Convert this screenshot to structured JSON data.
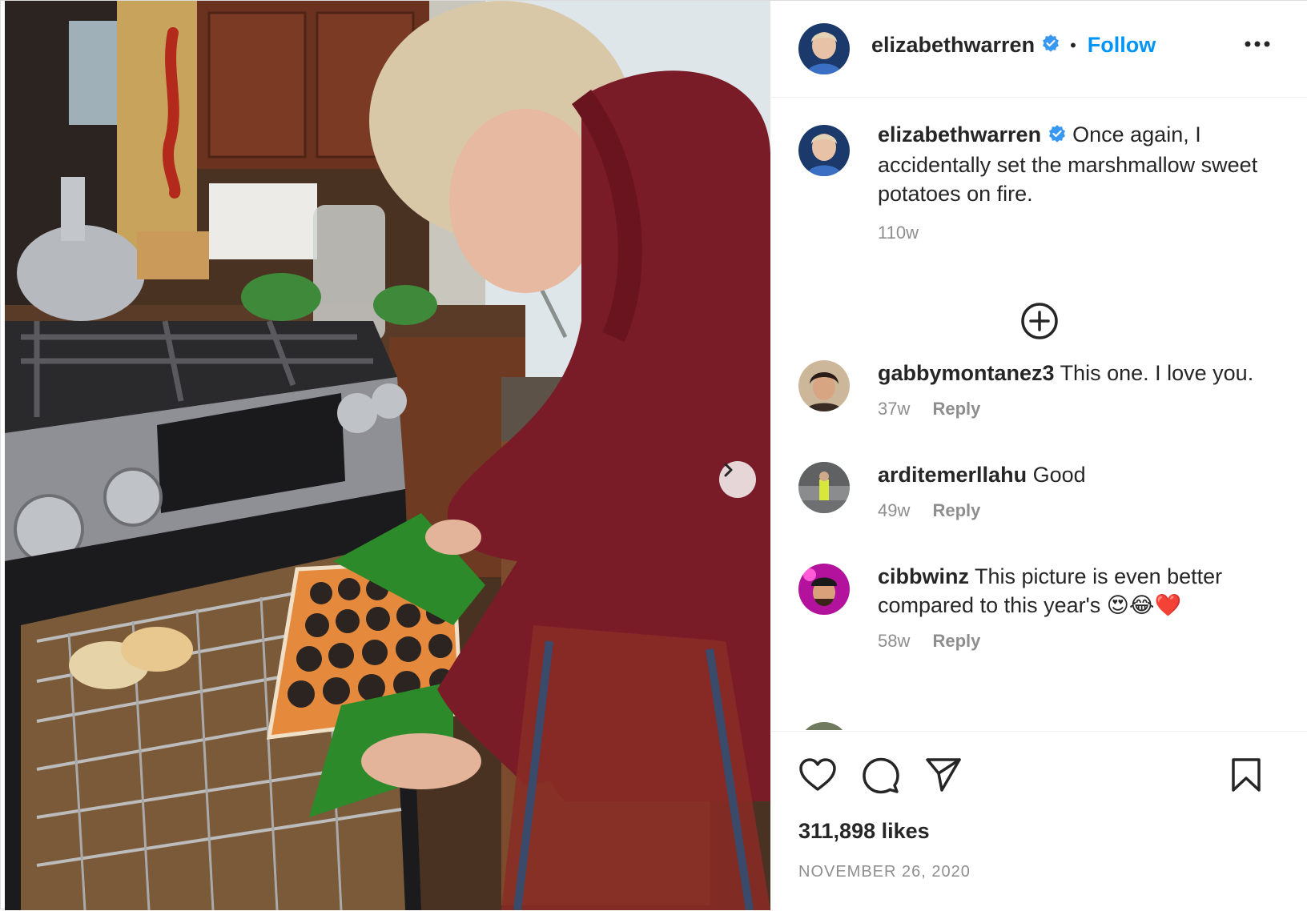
{
  "post": {
    "username": "elizabethwarren",
    "follow_label": "Follow",
    "separator": "•",
    "caption": "Once again, I accidentally set the marshmallow sweet potatoes on fire.",
    "caption_age": "110w",
    "likes": "311,898 likes",
    "date": "NOVEMBER 26, 2020"
  },
  "comments": [
    {
      "user": "gabbymontanez3",
      "text": "This one. I love you.",
      "age": "37w",
      "reply": "Reply"
    },
    {
      "user": "arditemerllahu",
      "text": "Good",
      "age": "49w",
      "reply": "Reply"
    },
    {
      "user": "cibbwinz",
      "text": "This picture is even better compared to this year's 😍😂❤️",
      "age": "58w",
      "reply": "Reply"
    }
  ],
  "icons": {
    "verified": "verified-badge-icon",
    "more": "more-options-icon",
    "load_more": "plus-circle-icon",
    "like": "heart-icon",
    "comment": "comment-icon",
    "share": "paper-plane-icon",
    "save": "bookmark-icon",
    "next": "chevron-right-icon"
  },
  "colors": {
    "accent": "#0095f6",
    "verified": "#3897f0",
    "secondary_text": "#8e8e8e"
  }
}
